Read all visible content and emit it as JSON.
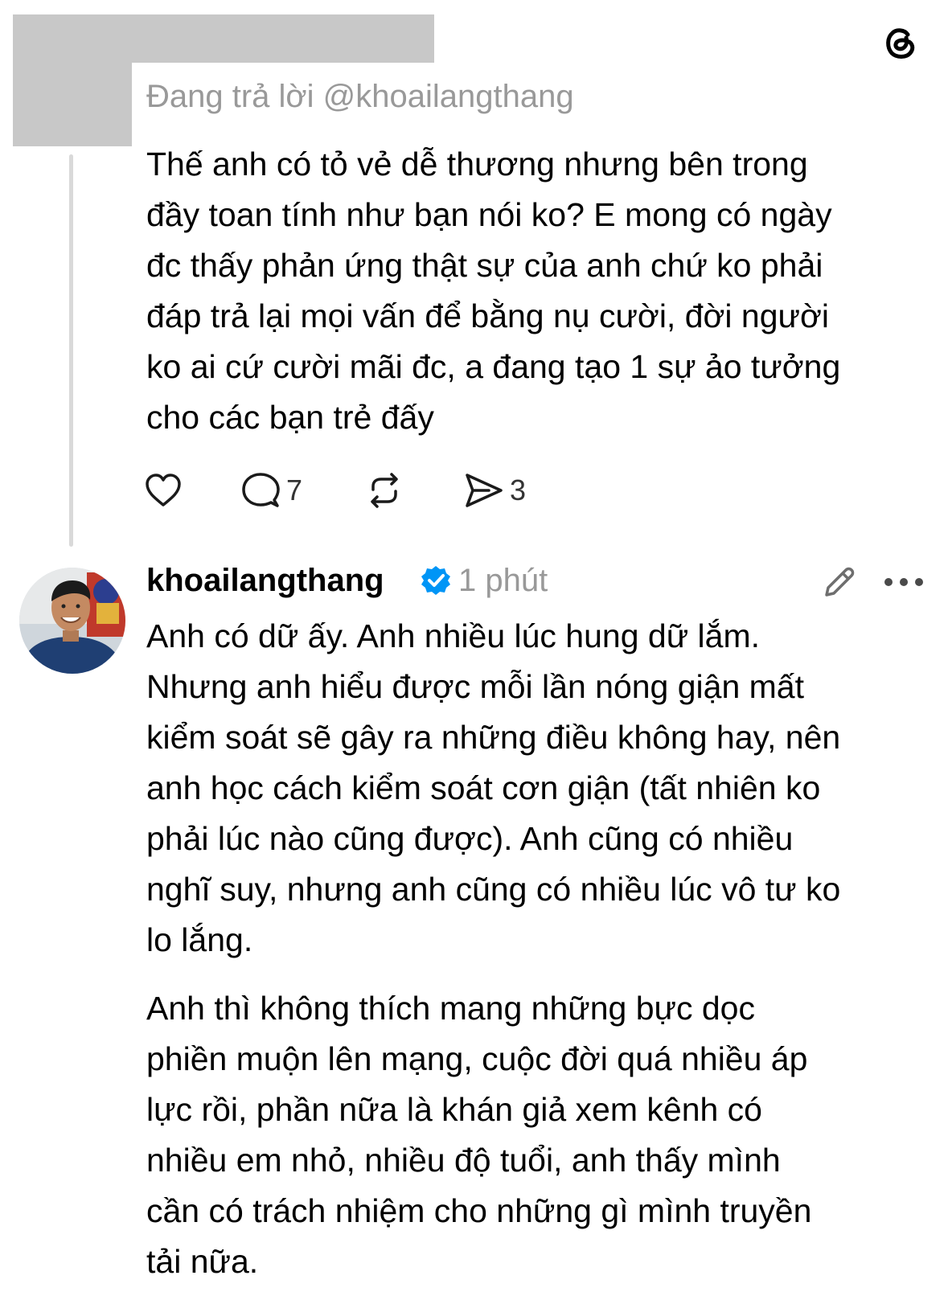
{
  "reply_header": {
    "replying_to": "Đang trả lời @khoailangthang"
  },
  "parent_post": {
    "text": "Thế anh có tỏ vẻ dễ thương nhưng bên trong\nđầy toan tính như bạn nói ko? E mong có ngày\nđc thấy phản ứng thật sự của anh chứ ko phải\nđáp trả lại mọi vấn để bằng nụ cười, đời người\nko ai cứ cười mãi đc, a đang tạo 1 sự ảo tưởng\ncho các bạn trẻ đấy",
    "actions": {
      "like_icon": "heart-icon",
      "reply_icon": "comment-icon",
      "reply_count": "7",
      "repost_icon": "repost-icon",
      "share_icon": "send-icon",
      "share_count": "3"
    }
  },
  "reply_post": {
    "username": "khoailangthang",
    "verified_icon": "verified-badge-icon",
    "timestamp": "1 phút",
    "paragraphs": [
      "Anh có dữ ấy. Anh nhiều lúc hung dữ lắm.\nNhưng anh hiểu được mỗi lần nóng giận mất\nkiểm soát sẽ gây ra những điều không hay, nên\nanh học cách kiểm soát cơn giận (tất nhiên ko\nphải lúc nào cũng được). Anh cũng có nhiều\nnghĩ suy, nhưng anh cũng có nhiều lúc vô tư ko\nlo lắng.",
      "Anh thì không thích mang những bực dọc\nphiền muộn lên mạng, cuộc đời quá nhiều áp\nlực rồi, phần nữa là khán giả xem kênh có\nnhiều em nhỏ, nhiều độ tuổi, anh thấy mình\ncần có trách nhiệm cho những gì mình truyền\ntải nữa."
    ]
  },
  "colors": {
    "text": "#000000",
    "muted": "#999999",
    "verified": "#0095f6",
    "redaction": "#c8c8c8",
    "thread_line": "#d9d9d9"
  }
}
